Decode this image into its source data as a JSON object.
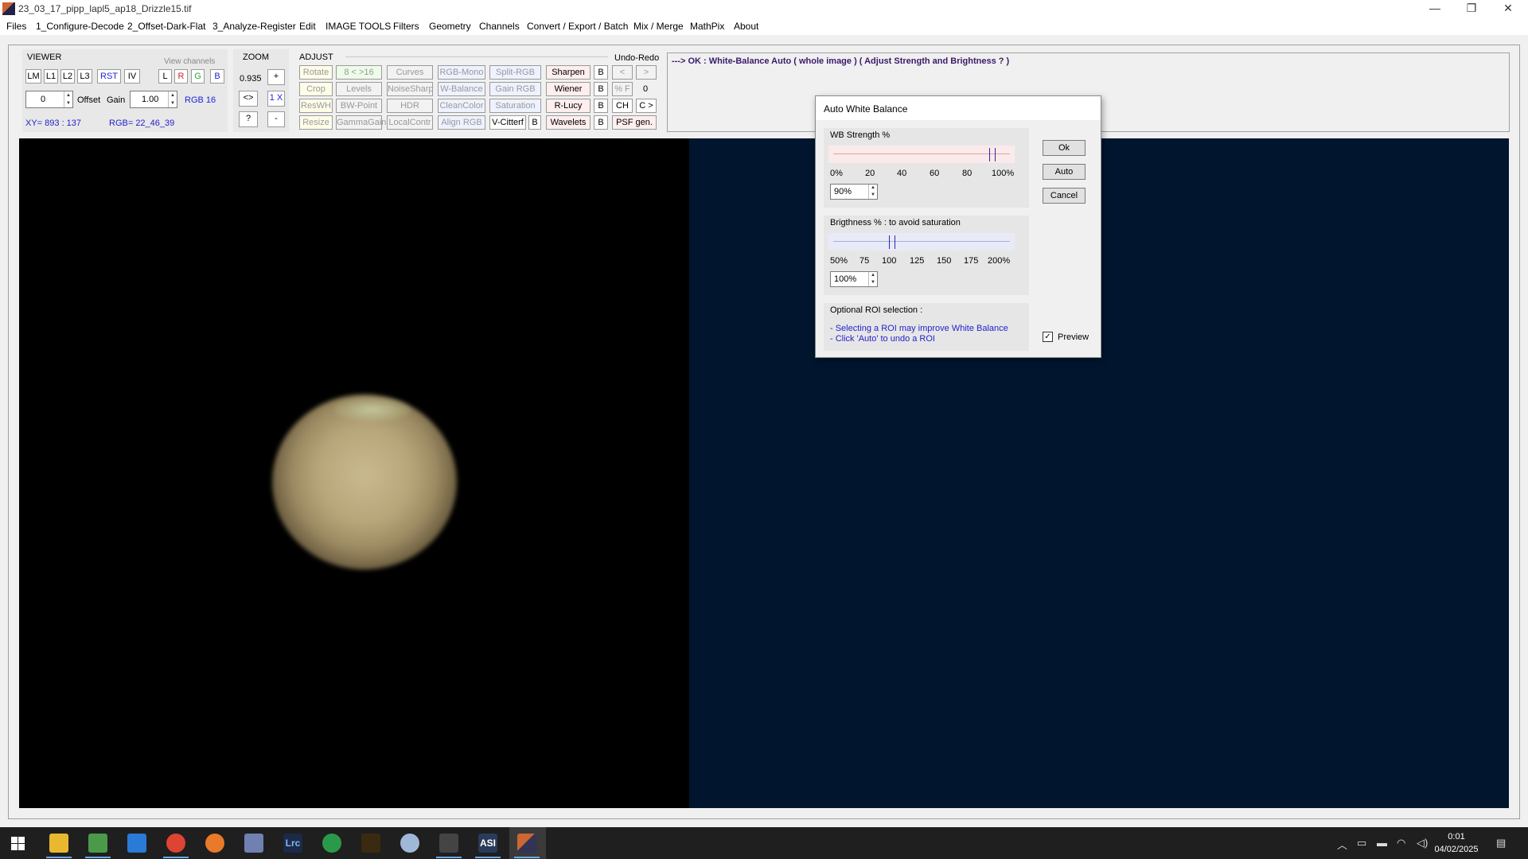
{
  "window": {
    "title": "23_03_17_pipp_lapl5_ap18_Drizzle15.tif",
    "minimize_glyph": "—",
    "restore_glyph": "❐",
    "close_glyph": "✕"
  },
  "menu": [
    "Files",
    "1_Configure-Decode",
    "2_Offset-Dark-Flat",
    "3_Analyze-Register",
    "Edit",
    "IMAGE TOOLS",
    "Filters",
    "Geometry",
    "Channels",
    "Convert / Export / Batch",
    "Mix / Merge",
    "MathPix",
    "About"
  ],
  "viewer": {
    "label": "VIEWER",
    "view_channels_label": "View channels",
    "buttons": [
      "LM",
      "L1",
      "L2",
      "L3",
      "RST",
      "IV"
    ],
    "channel_buttons": [
      "L",
      "R",
      "G",
      "B"
    ],
    "offset_value": "0",
    "offset_label": "Offset",
    "gain_label": "Gain",
    "gain_value": "1.00",
    "rgb_depth": "RGB 16",
    "xy_readout": "XY=  893 : 137",
    "rgb_readout": "RGB=  22_46_39"
  },
  "zoom": {
    "label": "ZOOM",
    "value": "0.935",
    "plus": "+",
    "fit": "<>",
    "one_x": "1 X",
    "help": "?",
    "minus": "-"
  },
  "adjust": {
    "label": "ADJUST",
    "undo_redo_label": "Undo-Redo",
    "rows": [
      [
        "Rotate",
        "8 < >16",
        "Curves",
        "RGB-Mono",
        "Split-RGB",
        "Sharpen",
        "B",
        "<",
        ">"
      ],
      [
        "Crop",
        "Levels",
        "NoiseSharp",
        "W-Balance",
        "Gain RGB",
        "Wiener",
        "B",
        "% F",
        "0"
      ],
      [
        "ResWH",
        "BW-Point",
        "HDR",
        "CleanColor",
        "Saturation",
        "R-Lucy",
        "B",
        "CH",
        "C >"
      ],
      [
        "Resize",
        "GammaGain",
        "LocalContr",
        "Align RGB",
        "V-Citterf",
        "B",
        "Wavelets",
        "B",
        "PSF gen."
      ]
    ]
  },
  "status": {
    "text": "---> OK :  White-Balance Auto   ( whole image )    ( Adjust Strength and Brightness  ? )"
  },
  "dialog": {
    "title": "Auto White Balance",
    "wb_strength": {
      "label": "WB Strength %",
      "ticks": [
        "0%",
        "20",
        "40",
        "60",
        "80",
        "100%"
      ],
      "value": "90%",
      "level_percent": 90
    },
    "brightness": {
      "label": "Brigthness %  :  to avoid saturation",
      "ticks": [
        "50%",
        "75",
        "100",
        "125",
        "150",
        "175",
        "200%"
      ],
      "value": "100%",
      "level_percent": 100
    },
    "roi": {
      "label": "Optional ROI selection :",
      "line1": "- Selecting a ROI may improve White Balance",
      "line2": "- Click 'Auto' to undo a ROI"
    },
    "buttons": {
      "ok": "Ok",
      "auto": "Auto",
      "cancel": "Cancel"
    },
    "preview_label": "Preview",
    "preview_checked": true
  },
  "taskbar": {
    "apps": [
      "windows-start",
      "file-explorer",
      "notepad",
      "vscode",
      "chrome",
      "firefox",
      "network-tool",
      "lightroom-classic",
      "gps-app",
      "astro-app",
      "paint-app",
      "stacker-app",
      "asi-studio",
      "wincast"
    ],
    "time": "0:01",
    "date": "04/02/2025"
  }
}
